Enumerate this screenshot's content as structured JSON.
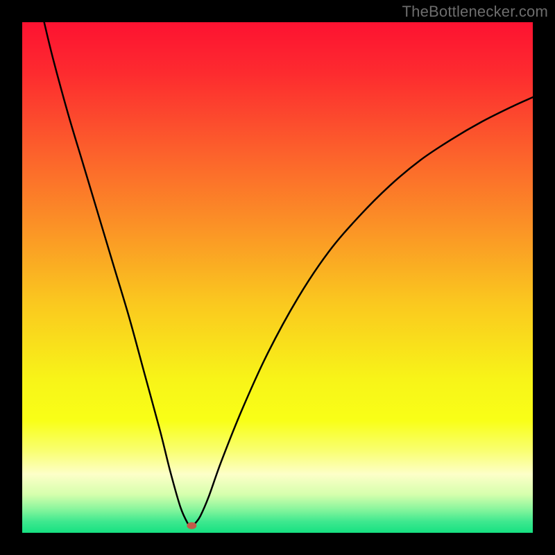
{
  "watermark": "TheBottlenecker.com",
  "chart_data": {
    "type": "line",
    "title": "",
    "xlabel": "",
    "ylabel": "",
    "xlim": [
      0,
      100
    ],
    "ylim": [
      0,
      100
    ],
    "grid": false,
    "background_gradient": {
      "stops": [
        {
          "offset": 0.0,
          "color": "#fd1231"
        },
        {
          "offset": 0.1,
          "color": "#fd2b2f"
        },
        {
          "offset": 0.25,
          "color": "#fc5f2c"
        },
        {
          "offset": 0.4,
          "color": "#fb9226"
        },
        {
          "offset": 0.55,
          "color": "#fac81f"
        },
        {
          "offset": 0.7,
          "color": "#f8f418"
        },
        {
          "offset": 0.78,
          "color": "#f9ff17"
        },
        {
          "offset": 0.84,
          "color": "#f9ff72"
        },
        {
          "offset": 0.885,
          "color": "#fdffc8"
        },
        {
          "offset": 0.925,
          "color": "#d6ffad"
        },
        {
          "offset": 0.955,
          "color": "#85f59c"
        },
        {
          "offset": 0.978,
          "color": "#3ee88f"
        },
        {
          "offset": 1.0,
          "color": "#16e181"
        }
      ]
    },
    "series": [
      {
        "name": "bottleneck-curve",
        "color": "#000000",
        "stroke_width": 2.5,
        "x": [
          4.3,
          6,
          9,
          12,
          15,
          18,
          21,
          24,
          27,
          29,
          31,
          32.5,
          33.0,
          33.5,
          34.0,
          34.9,
          36.5,
          39,
          43,
          48,
          54,
          60,
          66,
          72,
          78,
          84,
          90,
          96,
          100
        ],
        "y": [
          100,
          93,
          82,
          72,
          62,
          52,
          42,
          31,
          20,
          12,
          5,
          1.7,
          1.3,
          1.4,
          2.0,
          3.3,
          7,
          14,
          24,
          35,
          46,
          55,
          62,
          68,
          73,
          77,
          80.5,
          83.5,
          85.3
        ]
      }
    ],
    "marker": {
      "name": "optimal-point",
      "x": 33.2,
      "y": 1.4,
      "color": "#c25b49",
      "rx": 7,
      "ry": 5
    }
  }
}
